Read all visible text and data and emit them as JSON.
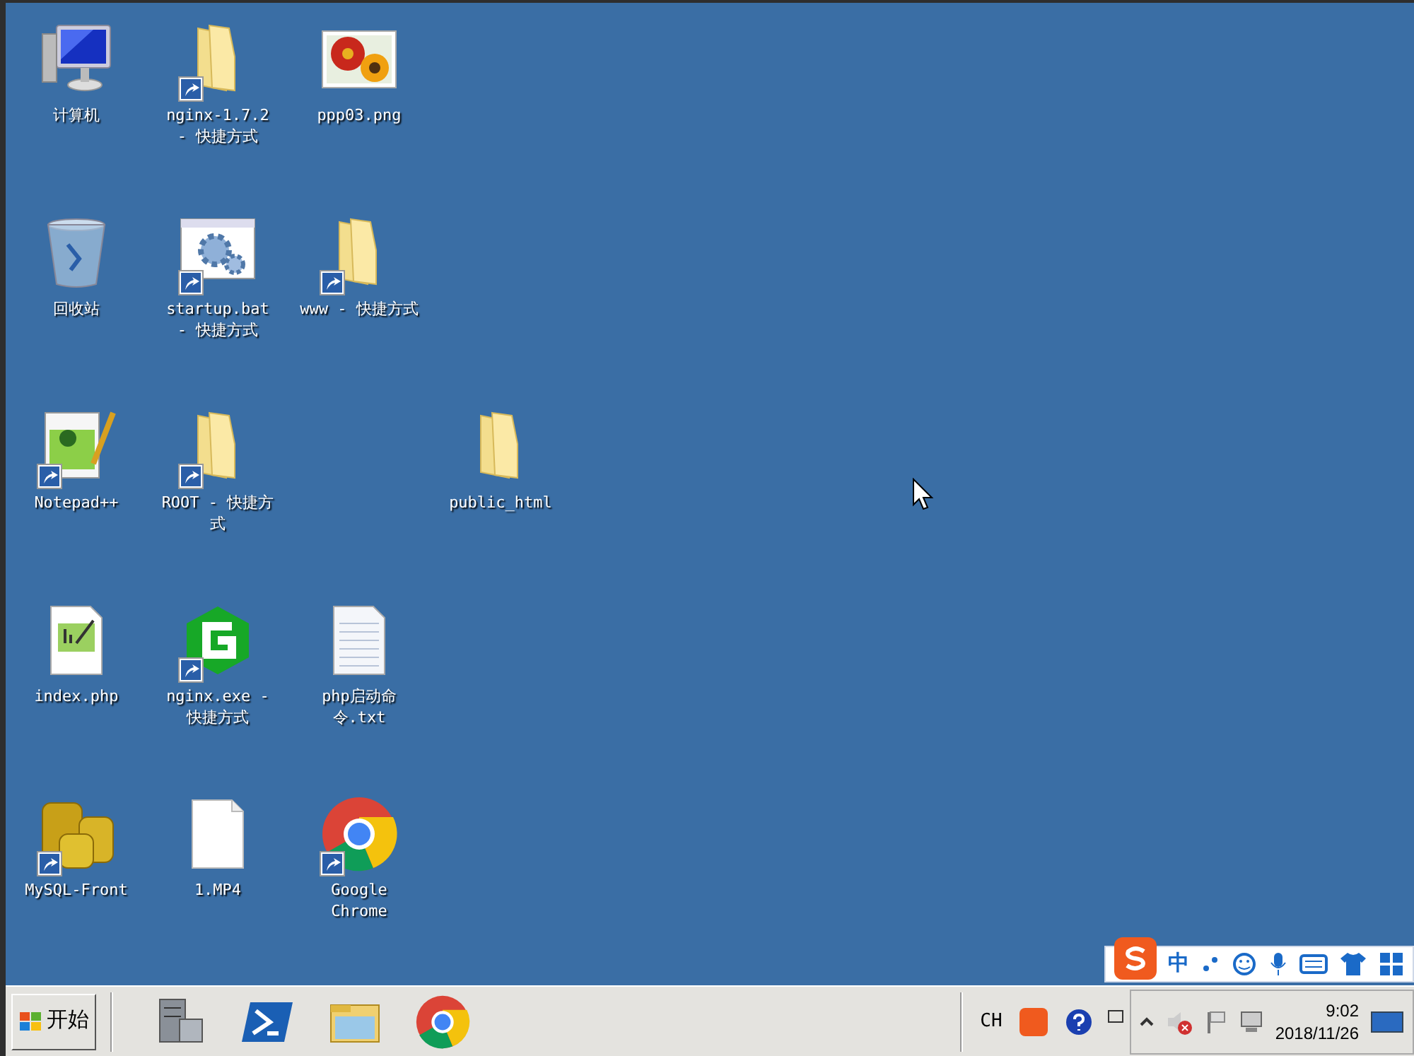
{
  "desktop": {
    "icons": [
      {
        "label": "计算机",
        "kind": "computer",
        "shortcut": false
      },
      {
        "label": "nginx-1.7.2 - 快捷方式",
        "kind": "folder",
        "shortcut": true
      },
      {
        "label": "ppp03.png",
        "kind": "image",
        "shortcut": false
      },
      {
        "label": "回收站",
        "kind": "recycle",
        "shortcut": false
      },
      {
        "label": "startup.bat - 快捷方式",
        "kind": "settings",
        "shortcut": true
      },
      {
        "label": "www - 快捷方式",
        "kind": "folder",
        "shortcut": true
      },
      {
        "label": "Notepad++",
        "kind": "notepad",
        "shortcut": true
      },
      {
        "label": "ROOT - 快捷方式",
        "kind": "folder",
        "shortcut": true
      },
      {
        "label": "public_html",
        "kind": "folder",
        "shortcut": false
      },
      {
        "label": "index.php",
        "kind": "php",
        "shortcut": false
      },
      {
        "label": "nginx.exe - 快捷方式",
        "kind": "nginx",
        "shortcut": true
      },
      {
        "label": "php启动命令.txt",
        "kind": "text",
        "shortcut": false
      },
      {
        "label": "MySQL-Front",
        "kind": "database",
        "shortcut": true
      },
      {
        "label": "1.MP4",
        "kind": "file",
        "shortcut": false
      },
      {
        "label": "Google Chrome",
        "kind": "chrome",
        "shortcut": true
      }
    ]
  },
  "ime_toolbar": {
    "mode": "中"
  },
  "taskbar": {
    "start": "开始",
    "pinned": [
      {
        "kind": "server"
      },
      {
        "kind": "powershell"
      },
      {
        "kind": "explorer"
      },
      {
        "kind": "chrome"
      }
    ],
    "tray": {
      "language": "CH",
      "time": "9:02",
      "date": "2018/11/26"
    }
  }
}
